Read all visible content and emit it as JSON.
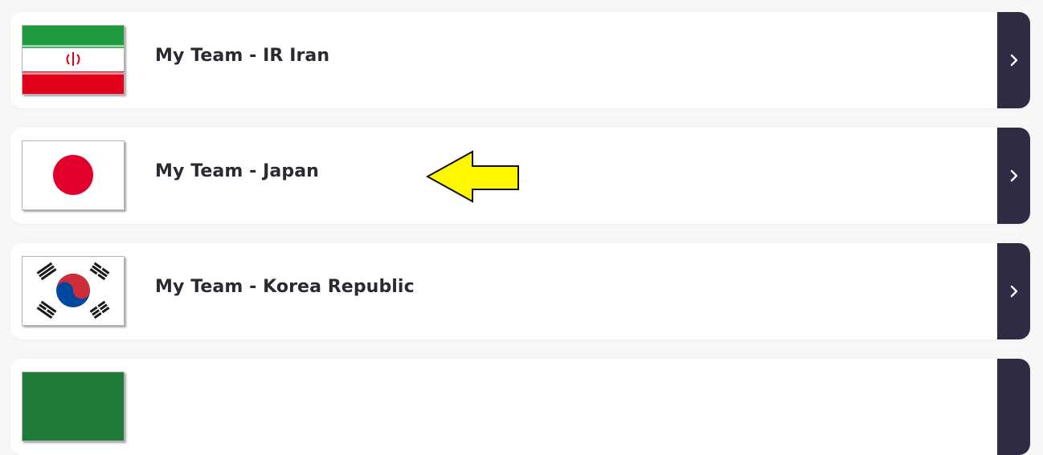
{
  "teams": [
    {
      "name": "My Team - IR Iran",
      "flag": "iran-flag",
      "colors": {
        "green": "#239f40",
        "white": "#ffffff",
        "red": "#da0000"
      }
    },
    {
      "name": "My Team - Japan",
      "flag": "japan-flag",
      "colors": {
        "white": "#ffffff",
        "red": "#e0002b"
      }
    },
    {
      "name": "My Team - Korea Republic",
      "flag": "korea-flag",
      "colors": {
        "white": "#ffffff",
        "red": "#cd2e3a",
        "blue": "#0047a0",
        "black": "#1a1a1a"
      }
    },
    {
      "name": "",
      "flag": "partial-flag",
      "colors": {
        "green": "#1f7a3a"
      }
    }
  ],
  "annotation": {
    "icon": "yellow-arrow-left",
    "color": "#fff700"
  },
  "nav": {
    "icon": "chevron-right-icon",
    "background": "#302b45"
  }
}
